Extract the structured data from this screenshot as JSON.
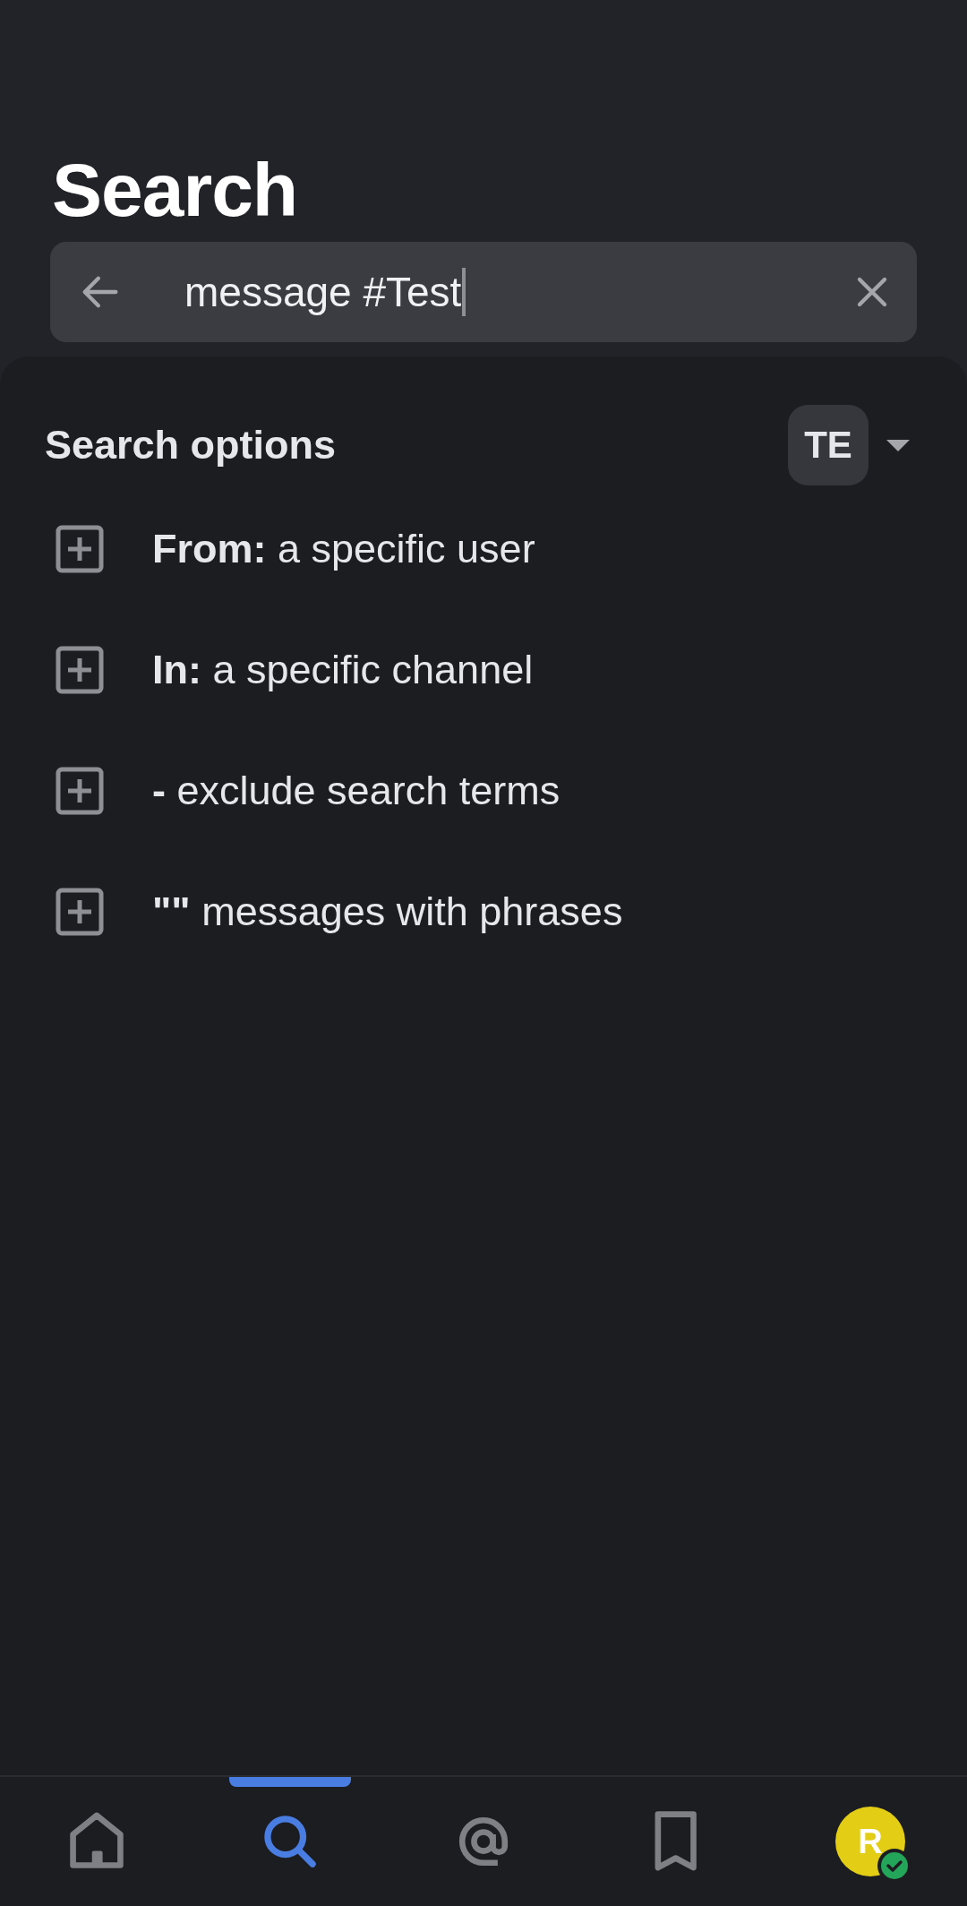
{
  "title": "Search",
  "search": {
    "value": "message #Test",
    "focused": true
  },
  "options_header": {
    "title": "Search options",
    "server_badge": "TE"
  },
  "options": [
    {
      "label": "**From:** a specific user"
    },
    {
      "label": "**In:** a specific channel"
    },
    {
      "label": "**-** exclude search terms"
    },
    {
      "label": "**\"\"** messages with phrases"
    }
  ],
  "nav": [
    {
      "kind": "home",
      "selected": false
    },
    {
      "kind": "search",
      "selected": true
    },
    {
      "kind": "mentions",
      "selected": false
    },
    {
      "kind": "saved",
      "selected": false
    },
    {
      "kind": "profile",
      "selected": false,
      "initial": "R",
      "online": true
    }
  ]
}
